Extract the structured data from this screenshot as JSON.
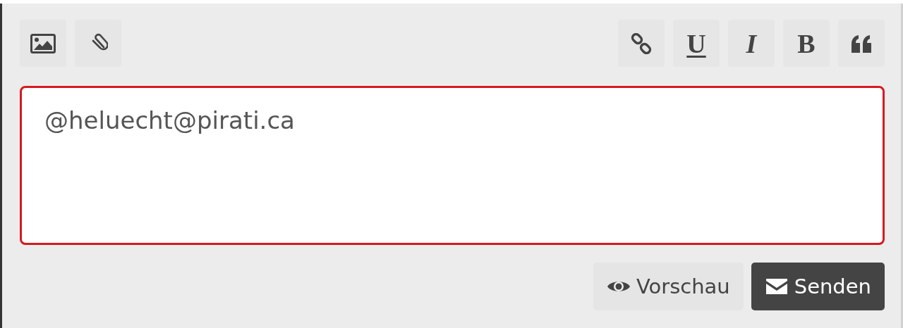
{
  "toolbar_left": [
    {
      "kind": "image"
    },
    {
      "kind": "attachment"
    }
  ],
  "toolbar_right": [
    {
      "kind": "link"
    },
    {
      "kind": "underline",
      "label": "U"
    },
    {
      "kind": "italic",
      "label": "I"
    },
    {
      "kind": "bold",
      "label": "B"
    },
    {
      "kind": "quote"
    }
  ],
  "editor": {
    "value": "@heluecht@pirati.ca",
    "focused": true
  },
  "actions": [
    {
      "kind": "preview",
      "label": "Vorschau"
    },
    {
      "kind": "send",
      "label": "Senden"
    }
  ]
}
